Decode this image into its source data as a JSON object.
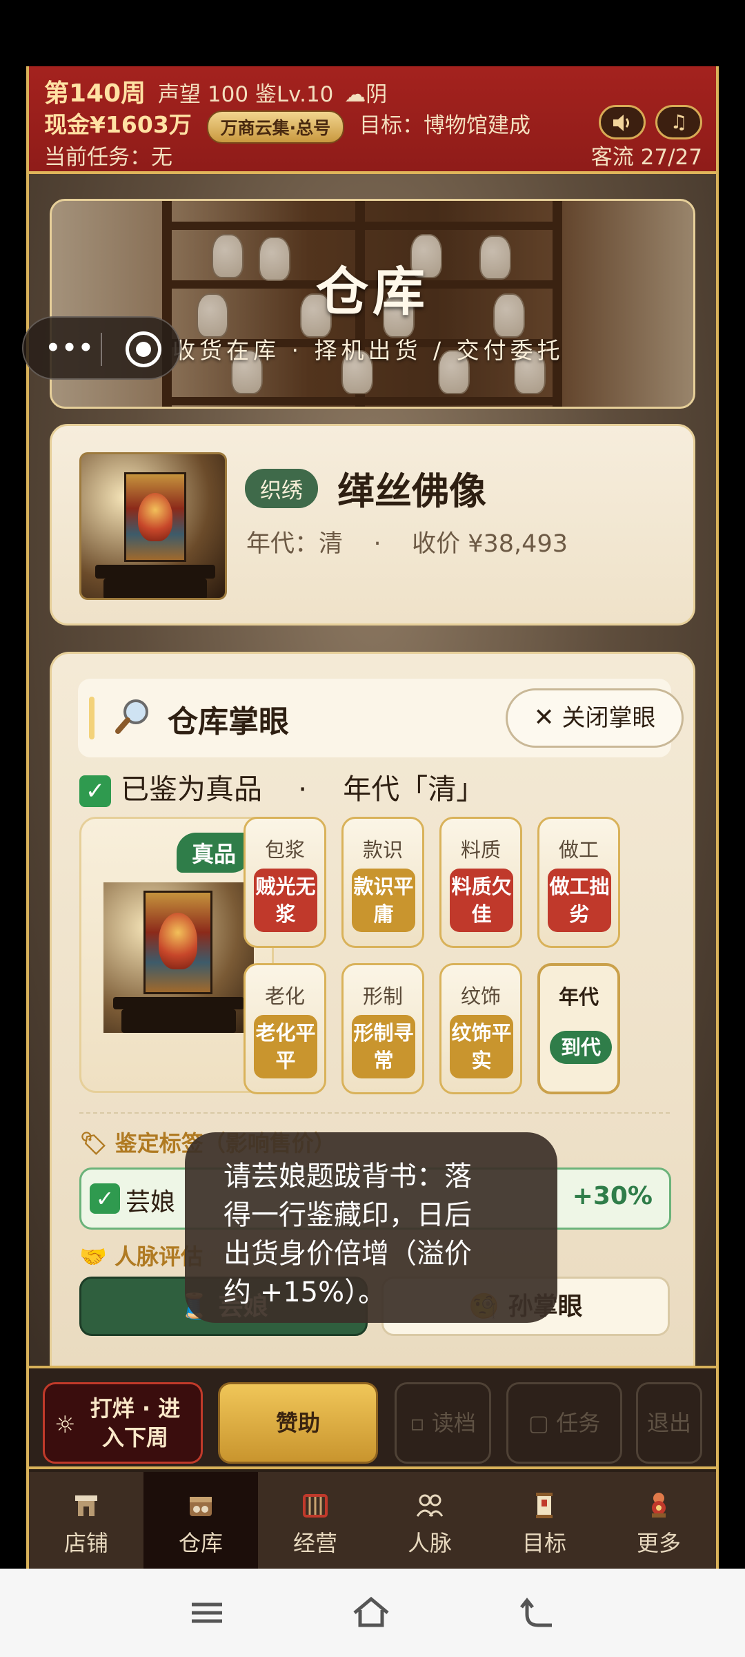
{
  "header": {
    "week": "第140周",
    "stats": "声望 100 鉴Lv.10",
    "weather_icon": "cloud-icon",
    "weather": "阴",
    "cash": "现金¥1603万",
    "shop_badge": "万商云集·总号",
    "goal": "目标：博物馆建成",
    "task": "当前任务：无",
    "traffic": "客流 27/27",
    "sound_icon": "speaker-icon",
    "music_icon": "music-note-icon"
  },
  "banner": {
    "title": "仓库",
    "subtitle": "收货在库 · 择机出货 / 交付委托"
  },
  "item": {
    "category": "织绣",
    "name": "缂丝佛像",
    "meta": "年代：清    ·    收价 ¥38,493"
  },
  "panel": {
    "title": "仓库掌眼",
    "close_label": "关闭掌眼",
    "verdict": "已鉴为真品    ·    年代「清」",
    "genuine_badge": "真品",
    "tiles": [
      {
        "title": "包浆",
        "tag": "贼光无浆",
        "color": "#c0392b"
      },
      {
        "title": "款识",
        "tag": "款识平庸",
        "color": "#c9952e"
      },
      {
        "title": "料质",
        "tag": "料质欠佳",
        "color": "#c0392b"
      },
      {
        "title": "做工",
        "tag": "做工拙劣",
        "color": "#c0392b"
      },
      {
        "title": "老化",
        "tag": "老化平平",
        "color": "#c9952e"
      },
      {
        "title": "形制",
        "tag": "形制寻常",
        "color": "#c9952e"
      },
      {
        "title": "纹饰",
        "tag": "纹饰平实",
        "color": "#c9952e"
      },
      {
        "title": "年代",
        "tag": "到代",
        "color": "#2f7d49"
      }
    ],
    "tags_label": "鉴定标签（影响售价）",
    "tag_row_text": "芸娘",
    "tag_bonus": "+30%",
    "contacts_label": "人脉评估",
    "contact_a": "芸娘",
    "contact_b": "孙掌眼"
  },
  "toast": {
    "lines": [
      "请芸娘题跋背书：落",
      "得一行鉴藏印，日后",
      "出货身价倍增（溢价",
      "约 +15%）。"
    ]
  },
  "actions": {
    "next_line1": "打烊 · 进",
    "next_line2": "入下周",
    "sponsor": "赞助",
    "load": "读档",
    "task": "任务",
    "exit": "退出"
  },
  "tabs": [
    {
      "label": "店铺",
      "icon": "shop-icon"
    },
    {
      "label": "仓库",
      "icon": "warehouse-icon",
      "active": true
    },
    {
      "label": "经营",
      "icon": "abacus-icon"
    },
    {
      "label": "人脉",
      "icon": "people-icon"
    },
    {
      "label": "目标",
      "icon": "scroll-icon"
    },
    {
      "label": "更多",
      "icon": "more-icon"
    }
  ]
}
